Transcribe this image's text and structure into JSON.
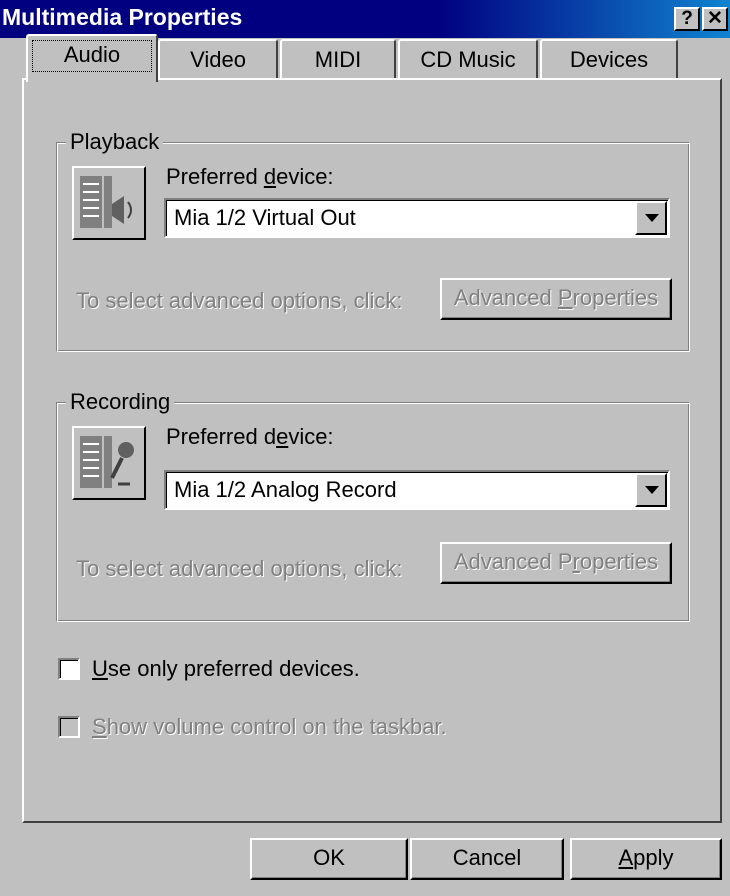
{
  "window": {
    "title": "Multimedia Properties",
    "help_label": "?",
    "close_label": "✕"
  },
  "tabs": [
    {
      "label": "Audio",
      "active": true
    },
    {
      "label": "Video",
      "active": false
    },
    {
      "label": "MIDI",
      "active": false
    },
    {
      "label": "CD Music",
      "active": false
    },
    {
      "label": "Devices",
      "active": false
    }
  ],
  "playback": {
    "group_label": "Playback",
    "preferred_label_pre": "Preferred ",
    "preferred_label_hot": "d",
    "preferred_label_post": "evice:",
    "device": "Mia 1/2 Virtual Out",
    "advanced_hint": "To select advanced options, click:",
    "advanced_pre": "Advanced ",
    "advanced_hot": "P",
    "advanced_post": "roperties"
  },
  "recording": {
    "group_label": "Recording",
    "preferred_label_pre": "Preferred d",
    "preferred_label_hot": "e",
    "preferred_label_post": "vice:",
    "device": "Mia 1/2 Analog Record",
    "advanced_hint": "To select advanced options, click:",
    "advanced_pre": "Advanced P",
    "advanced_hot": "r",
    "advanced_post": "operties"
  },
  "options": {
    "preferred_only_hot": "U",
    "preferred_only_rest": "se only preferred devices.",
    "preferred_only_checked": false,
    "volume_hot": "S",
    "volume_rest": "how volume control on the taskbar.",
    "volume_checked": false
  },
  "buttons": {
    "ok": "OK",
    "cancel": "Cancel",
    "apply_hot": "A",
    "apply_rest": "pply"
  }
}
